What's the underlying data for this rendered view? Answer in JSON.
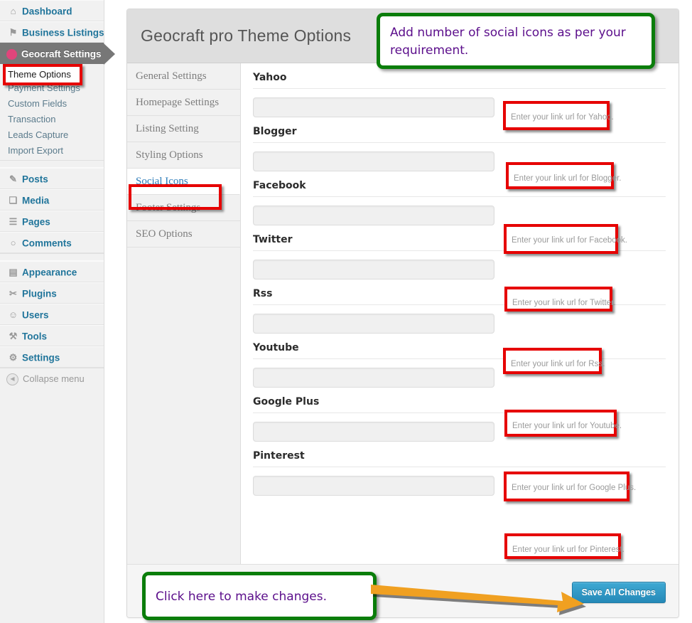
{
  "sidebar": {
    "items": [
      {
        "label": "Dashboard",
        "icon": "dashboard-icon",
        "glyph": "⌂"
      },
      {
        "label": "Business Listings",
        "icon": "business-listings-icon",
        "glyph": "⚑"
      },
      {
        "label": "Geocraft Settings",
        "icon": "geocraft-icon",
        "glyph": "Ⓕ"
      }
    ],
    "submenu": [
      {
        "label": "Theme Options"
      },
      {
        "label": "Payment Settings"
      },
      {
        "label": "Custom Fields"
      },
      {
        "label": "Transaction"
      },
      {
        "label": "Leads Capture"
      },
      {
        "label": "Import Export"
      }
    ],
    "items2": [
      {
        "label": "Posts",
        "icon": "pin-icon",
        "glyph": "✎"
      },
      {
        "label": "Media",
        "icon": "media-icon",
        "glyph": "❑"
      },
      {
        "label": "Pages",
        "icon": "pages-icon",
        "glyph": "☰"
      },
      {
        "label": "Comments",
        "icon": "comments-icon",
        "glyph": "○"
      }
    ],
    "items3": [
      {
        "label": "Appearance",
        "icon": "appearance-icon",
        "glyph": "▤"
      },
      {
        "label": "Plugins",
        "icon": "plugins-icon",
        "glyph": "✂"
      },
      {
        "label": "Users",
        "icon": "users-icon",
        "glyph": "☺"
      },
      {
        "label": "Tools",
        "icon": "tools-icon",
        "glyph": "⚒"
      },
      {
        "label": "Settings",
        "icon": "settings-icon",
        "glyph": "⚙"
      }
    ],
    "collapse": {
      "label": "Collapse menu",
      "icon": "collapse-arrow-icon",
      "glyph": "◀"
    }
  },
  "panel": {
    "title": "Geocraft pro Theme Options",
    "tabs": [
      {
        "label": "General Settings"
      },
      {
        "label": "Homepage Settings"
      },
      {
        "label": "Listing Setting"
      },
      {
        "label": "Styling Options"
      },
      {
        "label": "Social Icons"
      },
      {
        "label": "Footer Settings"
      },
      {
        "label": "SEO Options"
      }
    ],
    "active_tab": "Social Icons",
    "fields": [
      {
        "label": "Yahoo",
        "value": "",
        "hint": "Enter your link url for Yahoo."
      },
      {
        "label": "Blogger",
        "value": "",
        "hint": "Enter your link url for Blogger."
      },
      {
        "label": "Facebook",
        "value": "",
        "hint": "Enter your link url for Facebook."
      },
      {
        "label": "Twitter",
        "value": "",
        "hint": "Enter your link url for Twitter."
      },
      {
        "label": "Rss",
        "value": "",
        "hint": "Enter your link url for Rss."
      },
      {
        "label": "Youtube",
        "value": "",
        "hint": "Enter your link url for Youtube."
      },
      {
        "label": "Google Plus",
        "value": "",
        "hint": "Enter your link url for Google Plus."
      },
      {
        "label": "Pinterest",
        "value": "",
        "hint": "Enter your link url for Pinterest."
      }
    ],
    "save_label": "Save All Changes"
  },
  "annotations": {
    "top_note": "Add number of social icons as per your requirement.",
    "bottom_note": "Click here to make changes.",
    "highlight_theme_options": "Theme Options",
    "colors": {
      "callout_border": "#0a7d0a",
      "callout_text": "#5b0e8b",
      "highlight_border": "#e60000",
      "arrow": "#f0a021",
      "save_button": "#2589b8",
      "geocraft_badge": "#e0457b"
    }
  }
}
